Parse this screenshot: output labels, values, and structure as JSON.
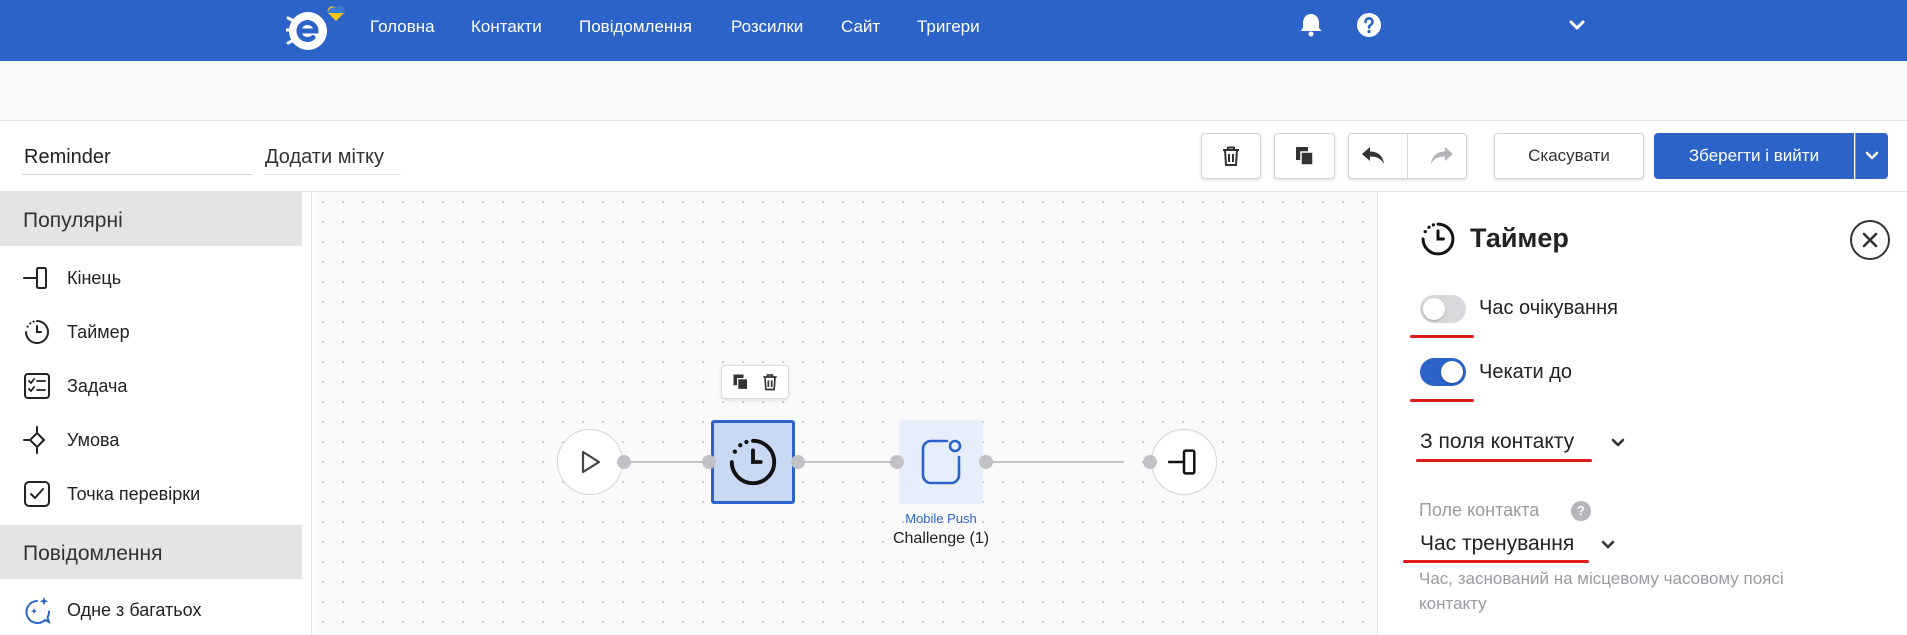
{
  "nav": {
    "items": [
      "Головна",
      "Контакти",
      "Повідомлення",
      "Розсилки",
      "Сайт",
      "Тригери"
    ],
    "icons": [
      "bell-icon",
      "help-icon",
      "chevron-down-icon"
    ]
  },
  "toolbar": {
    "workflow_name": "Reminder",
    "tag_placeholder": "Додати мітку",
    "cancel_label": "Скасувати",
    "save_label": "Зберегти і вийти"
  },
  "sidebar": {
    "sections": [
      {
        "title": "Популярні",
        "items": [
          {
            "label": "Кінець",
            "icon": "exit-icon"
          },
          {
            "label": "Таймер",
            "icon": "timer-icon"
          },
          {
            "label": "Задача",
            "icon": "checklist-icon"
          },
          {
            "label": "Умова",
            "icon": "condition-icon"
          },
          {
            "label": "Точка перевірки",
            "icon": "checkpoint-icon"
          }
        ]
      },
      {
        "title": "Повідомлення",
        "items": [
          {
            "label": "Одне з багатьох",
            "icon": "sparkle-chat-icon"
          }
        ]
      }
    ]
  },
  "canvas": {
    "push_node": {
      "type_label": "Mobile Push",
      "name": "Challenge (1)"
    }
  },
  "panel": {
    "title": "Таймер",
    "wait_time_label": "Час очікування",
    "wait_time_enabled": false,
    "wait_until_label": "Чекати до",
    "wait_until_enabled": true,
    "source_select": "З поля контакту",
    "field_label": "Поле контакта",
    "field_select": "Час тренування",
    "hint": "Час, заснований на місцевому часовому поясі контакту"
  },
  "colors": {
    "brand": "#2c63c9",
    "annotation_red": "#e01b1b"
  }
}
